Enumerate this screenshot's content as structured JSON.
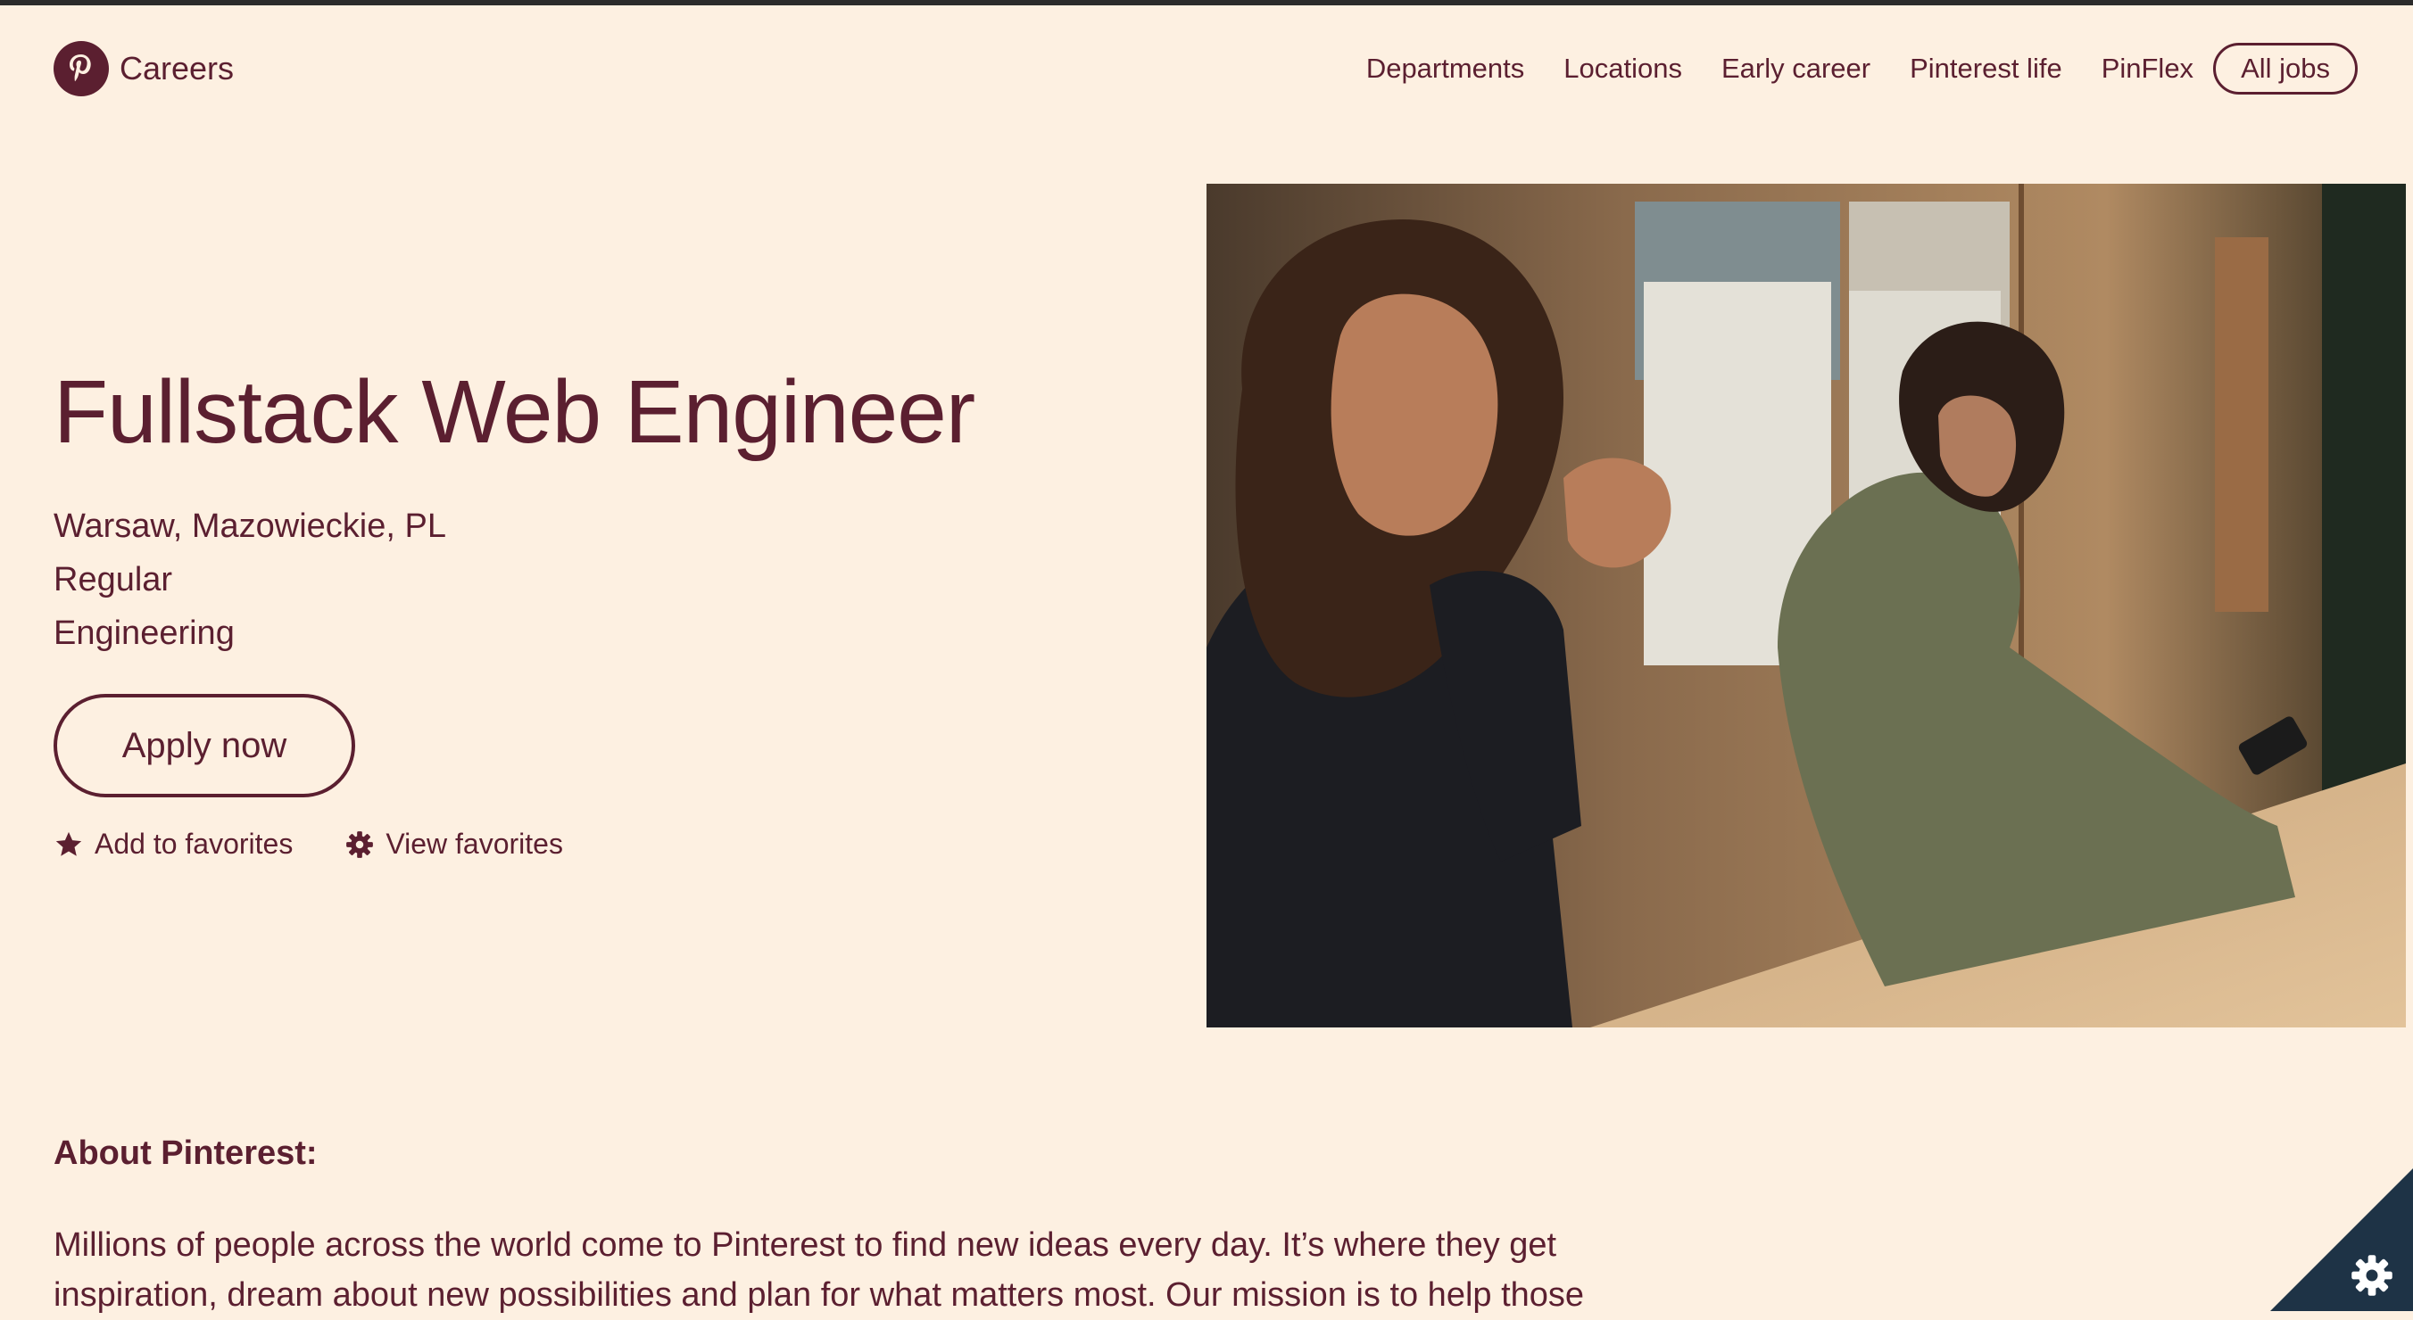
{
  "header": {
    "brand": "Careers",
    "nav": [
      "Departments",
      "Locations",
      "Early career",
      "Pinterest life",
      "PinFlex"
    ],
    "all_jobs": "All jobs"
  },
  "job": {
    "title": "Fullstack Web Engineer",
    "location": "Warsaw, Mazowieckie, PL",
    "type": "Regular",
    "department": "Engineering",
    "apply_label": "Apply now",
    "add_favorites": "Add to favorites",
    "view_favorites": "View favorites"
  },
  "about": {
    "heading": "About Pinterest:",
    "text": "Millions of people across the world come to Pinterest to find new ideas every day. It’s where they get inspiration, dream about new possibilities and plan for what matters most. Our mission is to help those"
  },
  "colors": {
    "background": "#fdf0e1",
    "brand": "#5b1f30",
    "corner_widget": "#1e3346"
  },
  "icons": [
    "pinterest-logo-icon",
    "star-icon",
    "gear-icon",
    "settings-gear-icon"
  ]
}
